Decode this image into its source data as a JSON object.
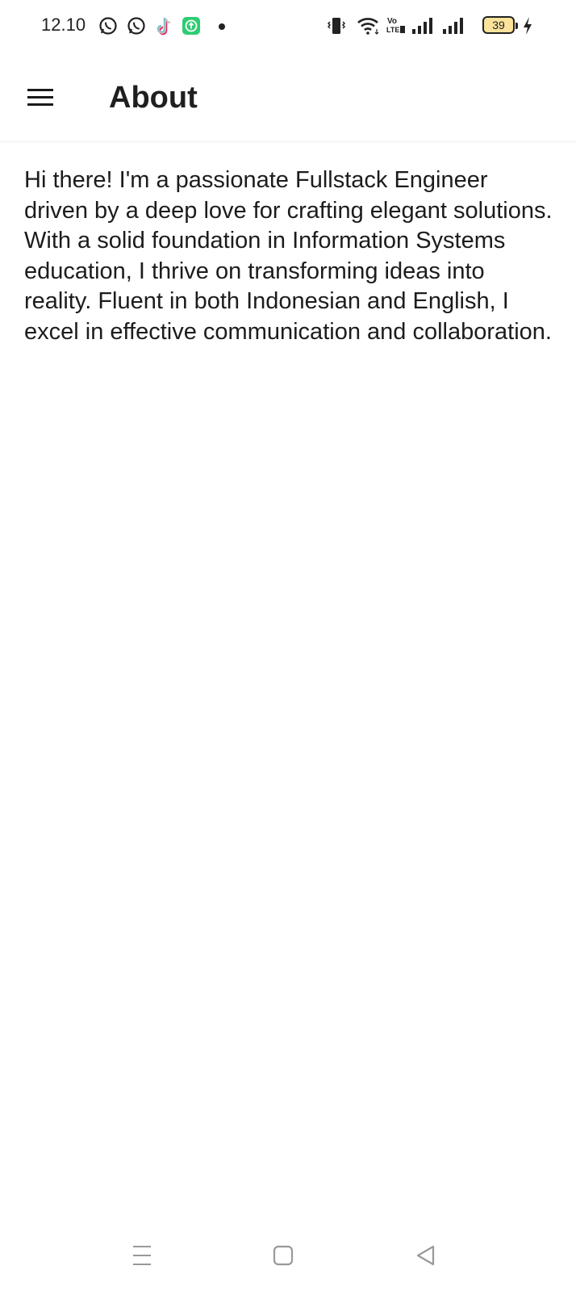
{
  "status_bar": {
    "time": "12.10",
    "battery": "39",
    "notification_icons": [
      "whatsapp-icon",
      "whatsapp-icon",
      "tiktok-icon",
      "upload-app-icon"
    ],
    "system_icons": [
      "vibrate-icon",
      "wifi-icon",
      "volte-icon",
      "signal-icon",
      "signal-icon",
      "battery-icon",
      "charging-icon"
    ],
    "battery_fill_color": "#fbe39b"
  },
  "app_bar": {
    "title": "About",
    "menu_icon": "hamburger-menu-icon"
  },
  "content": {
    "about_text": "Hi there! I'm a passionate Fullstack Engineer driven by a deep love for crafting elegant solutions. With a solid foundation in Information Systems education, I thrive on transforming ideas into reality. Fluent in both Indonesian and English, I excel in effective communication and collaboration."
  },
  "nav_bar": {
    "buttons": [
      "recents-icon",
      "home-icon",
      "back-icon"
    ]
  }
}
